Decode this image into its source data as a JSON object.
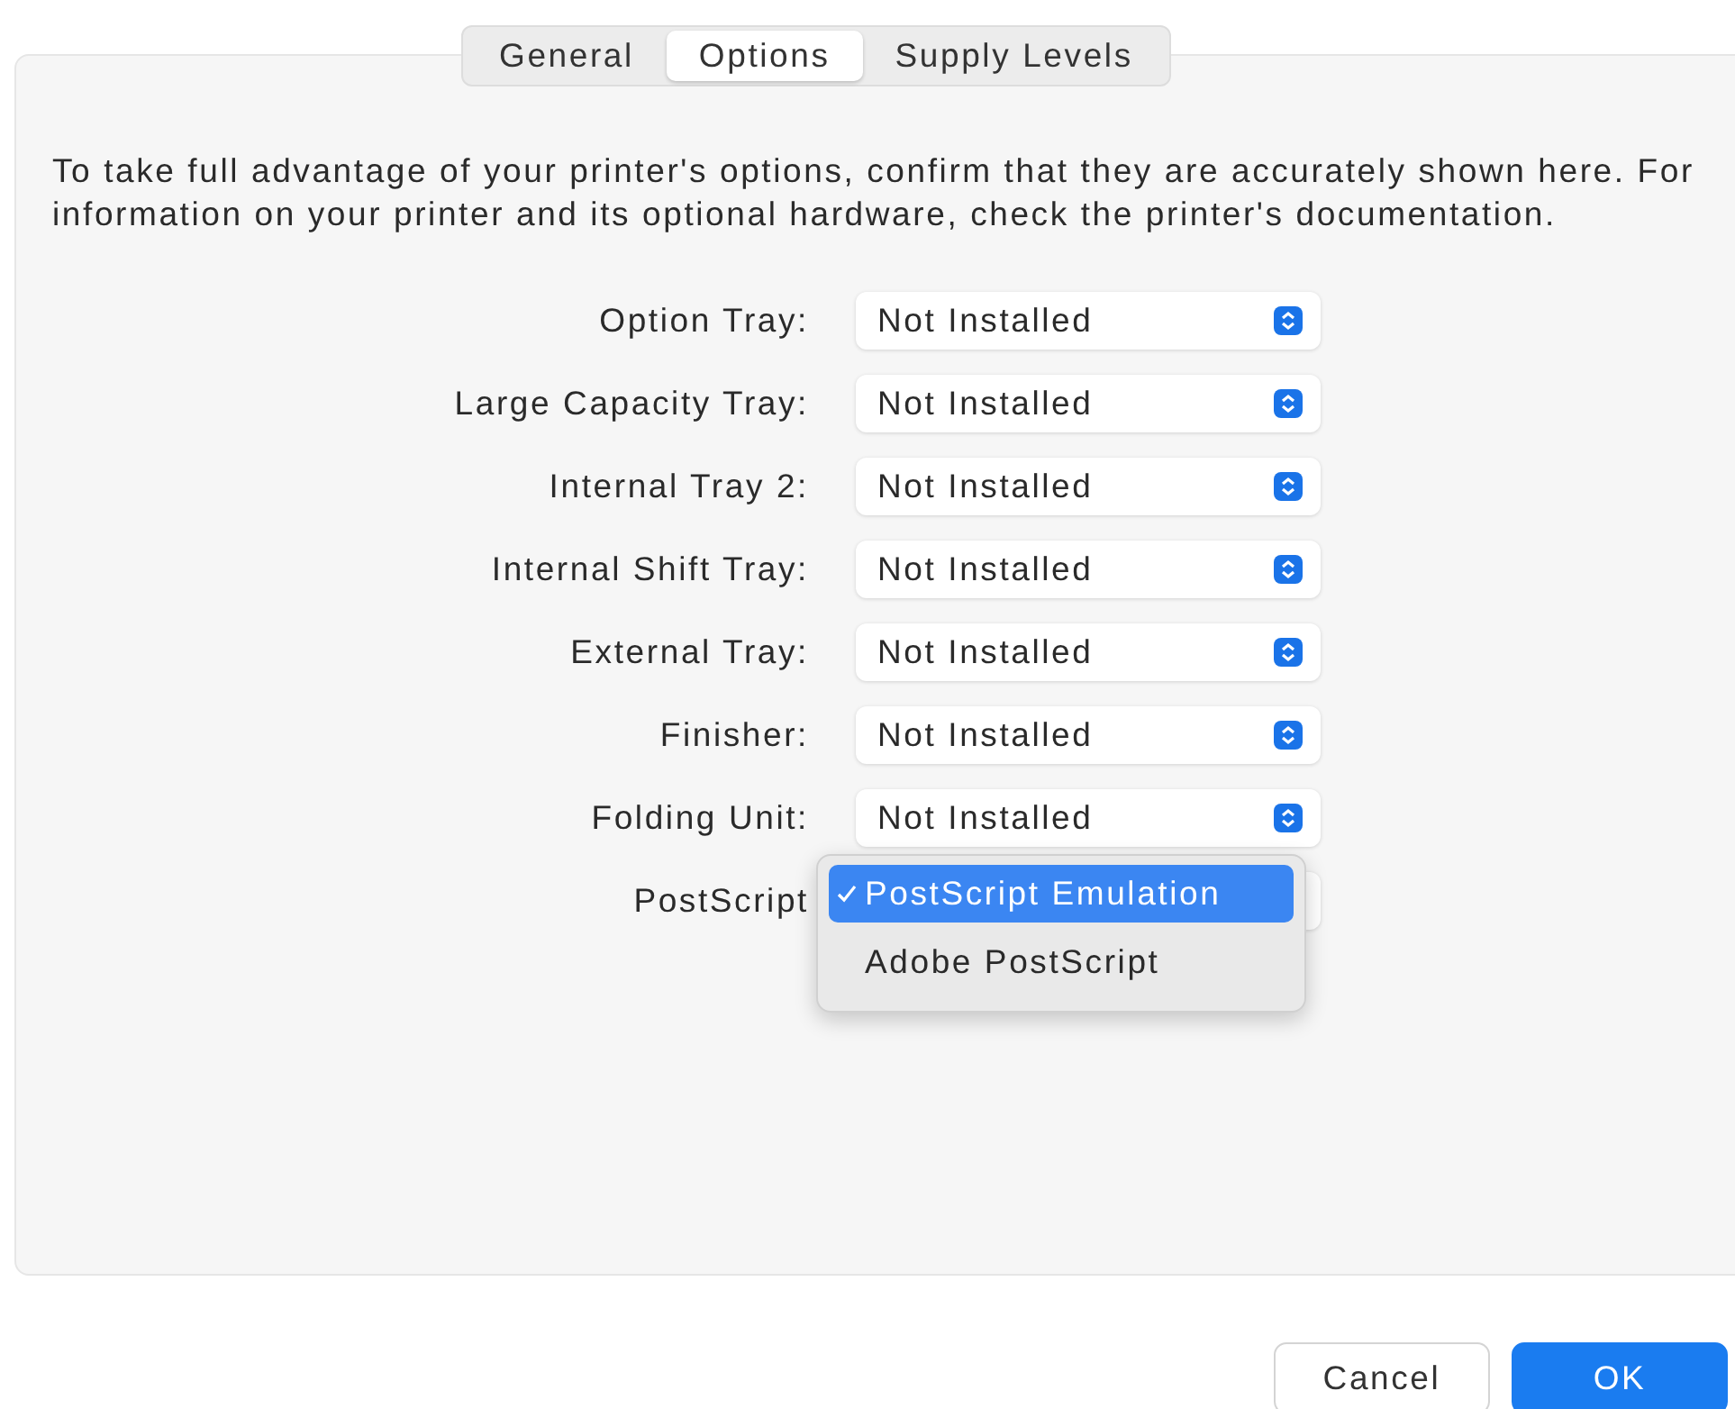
{
  "tabs": [
    {
      "label": "General",
      "selected": false
    },
    {
      "label": "Options",
      "selected": true
    },
    {
      "label": "Supply Levels",
      "selected": false
    }
  ],
  "description": "To take full advantage of your printer's options, confirm that they are accurately shown here. For information on your printer and its optional hardware, check the printer's documentation.",
  "options": [
    {
      "label": "Option Tray:",
      "value": "Not Installed"
    },
    {
      "label": "Large Capacity Tray:",
      "value": "Not Installed"
    },
    {
      "label": "Internal Tray 2:",
      "value": "Not Installed"
    },
    {
      "label": "Internal Shift Tray:",
      "value": "Not Installed"
    },
    {
      "label": "External Tray:",
      "value": "Not Installed"
    },
    {
      "label": "Finisher:",
      "value": "Not Installed"
    },
    {
      "label": "Folding Unit:",
      "value": "Not Installed"
    },
    {
      "label": "PostScript",
      "open_menu": [
        {
          "label": "PostScript Emulation",
          "selected": true
        },
        {
          "label": "Adobe PostScript",
          "selected": false
        }
      ]
    }
  ],
  "buttons": [
    {
      "label": "Cancel",
      "kind": "secondary"
    },
    {
      "label": "OK",
      "kind": "primary"
    }
  ]
}
